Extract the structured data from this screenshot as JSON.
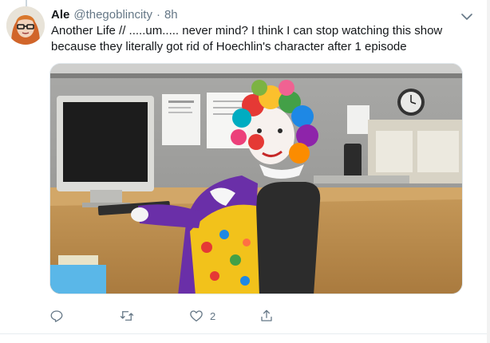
{
  "tweet": {
    "display_name": "Ale",
    "handle": "@thegoblincity",
    "separator": "·",
    "time": "8h",
    "text": "Another Life // .....um..... never mind? I think I can stop watching this show because they literally got rid of Hoechlin's character after 1 episode"
  },
  "actions": {
    "reply_count": "",
    "retweet_count": "",
    "like_count": "2",
    "share_count": ""
  },
  "colors": {
    "text_primary": "#14171a",
    "text_secondary": "#657786",
    "border": "#e6ecf0"
  },
  "icons": [
    "chevron-down-icon",
    "reply-icon",
    "retweet-icon",
    "like-icon",
    "share-icon"
  ]
}
